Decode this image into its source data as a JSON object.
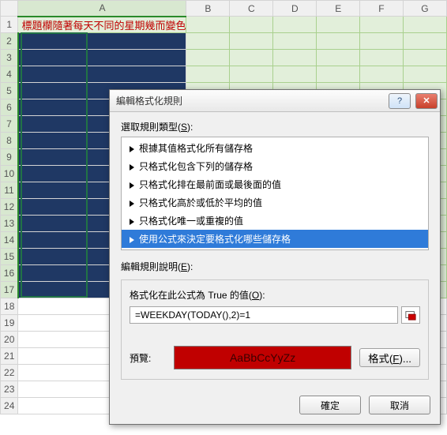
{
  "sheet": {
    "col_headers": [
      "A",
      "B",
      "C",
      "D",
      "E",
      "F",
      "G"
    ],
    "row_count": 24,
    "a1_text": "標題欄隨著每天不同的星期幾而變色",
    "selected_col": "A",
    "selection": {
      "top_row": 2,
      "bottom_row": 17
    }
  },
  "dialog": {
    "title": "編輯格式化規則",
    "help_glyph": "?",
    "close_glyph": "✕",
    "section_label_pre": "選取規則類型(",
    "section_label_u": "S",
    "section_label_post": "):",
    "rule_types": [
      "根據其值格式化所有儲存格",
      "只格式化包含下列的儲存格",
      "只格式化排在最前面或最後面的值",
      "只格式化高於或低於平均的值",
      "只格式化唯一或重複的值",
      "使用公式來決定要格式化哪些儲存格"
    ],
    "selected_rule_index": 5,
    "edit_label_pre": "編輯規則說明(",
    "edit_label_u": "E",
    "edit_label_post": "):",
    "formula_label_pre": "格式化在此公式為 True 的值(",
    "formula_label_u": "O",
    "formula_label_post": "):",
    "formula_value": "=WEEKDAY(TODAY(),2)=1",
    "preview_label": "預覽:",
    "preview_sample": "AaBbCcYyZz",
    "format_button_pre": "格式(",
    "format_button_u": "F",
    "format_button_post": ")...",
    "ok": "確定",
    "cancel": "取消"
  }
}
